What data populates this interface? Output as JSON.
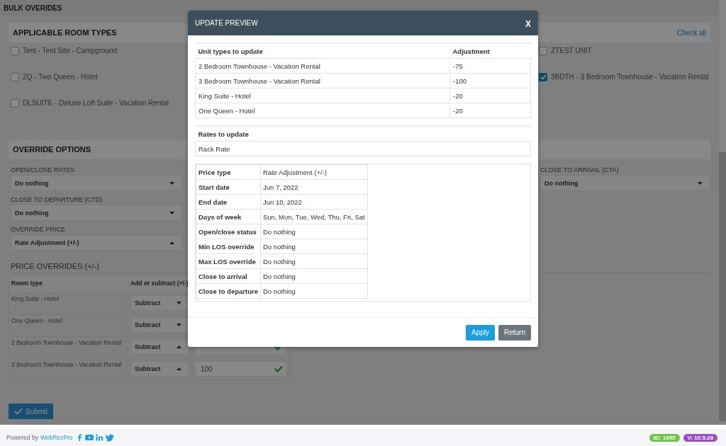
{
  "page_title": "BULK OVERIDES",
  "room_types": {
    "title": "APPLICABLE ROOM TYPES",
    "check_all": "Check all",
    "left_column": [
      {
        "label": "Tent - Tent Site - Campground",
        "checked": false
      },
      {
        "label": "2Q - Two Queen - Hotel",
        "checked": false
      },
      {
        "label": "DLSUITE - Deluxe Loft Suite - Vacation Rental",
        "checked": false
      }
    ],
    "right_column": [
      {
        "label": "ZTEST UNIT",
        "checked": false
      },
      {
        "label": "3BDTH - 3 Bedroom Townhouse - Vacation Rental",
        "checked": true
      }
    ]
  },
  "override_options": {
    "title": "OVERRIDE OPTIONS",
    "rows": [
      [
        {
          "label": "OPEN/CLOSE RATES",
          "value": "Do nothing",
          "expanded": false
        },
        null,
        null,
        {
          "label": "CLOSE TO ARRIVAL (CTA)",
          "value": "Do nothing",
          "expanded": false
        }
      ],
      [
        {
          "label": "CLOSE TO DEPARTURE (CTD)",
          "value": "Do nothing",
          "expanded": false
        }
      ],
      [
        {
          "label": "OVERRIDE PRICE",
          "value": "Rate Adjustment (+/-)",
          "expanded": true
        }
      ]
    ]
  },
  "price_overrides": {
    "title": "PRICE OVERRIDES (+/-)",
    "columns": [
      "Room type",
      "Add or subtract (+/-)"
    ],
    "rows": [
      {
        "room_type": "King Suite - Hotel",
        "operation": "Subtract",
        "expanded": false
      },
      {
        "room_type": "One Queen - Hotel",
        "operation": "Subtract",
        "expanded": false
      },
      {
        "room_type": "2 Bedroom Townhouse - Vacation Rental",
        "operation": "Subtract",
        "expanded": true,
        "valid": true
      },
      {
        "room_type": "3 Bedroom Townhouse - Vacation Rental",
        "operation": "Subtract",
        "expanded": true,
        "amount": "100",
        "valid": true
      }
    ]
  },
  "submit": "Submit",
  "modal": {
    "title": "UPDATE PREVIEW",
    "close": "X",
    "unit_columns": [
      "Unit types to update",
      "Adjustment"
    ],
    "unit_rows": [
      [
        "2 Bedroom Townhouse - Vacation Rental",
        "-75"
      ],
      [
        "3 Bedroom Townhouse - Vacation Rental",
        "-100"
      ],
      [
        "King Suite - Hotel",
        "-20"
      ],
      [
        "One Queen - Hotel",
        "-20"
      ]
    ],
    "rates_heading": "Rates to update",
    "rates": [
      "Rack Rate"
    ],
    "details": [
      {
        "label": "Price type",
        "value": "Rate Adjustment (+/-)"
      },
      {
        "label": "Start date",
        "value": "Jun 7, 2022"
      },
      {
        "label": "End date",
        "value": "Jun 10, 2022"
      },
      {
        "label": "Days of week",
        "value": "Sun, Mon, Tue, Wed, Thu, Fri, Sat"
      },
      {
        "label": "Open/close status",
        "value": "Do nothing"
      },
      {
        "label": "Min LOS override",
        "value": "Do nothing"
      },
      {
        "label": "Max LOS override",
        "value": "Do nothing"
      },
      {
        "label": "Close to arrival",
        "value": "Do nothing"
      },
      {
        "label": "Close to departure",
        "value": "Do nothing"
      }
    ],
    "buttons": [
      {
        "label": "Apply",
        "kind": "primary"
      },
      {
        "label": "Return",
        "kind": "secondary"
      }
    ]
  },
  "footer": {
    "powered_by": "Powered by",
    "brand": "WebRezPro",
    "badges": [
      {
        "text": "ID: 1655",
        "color": "#6cc644"
      },
      {
        "text": "V: 10.5.28",
        "color": "#9b4dca"
      }
    ]
  }
}
